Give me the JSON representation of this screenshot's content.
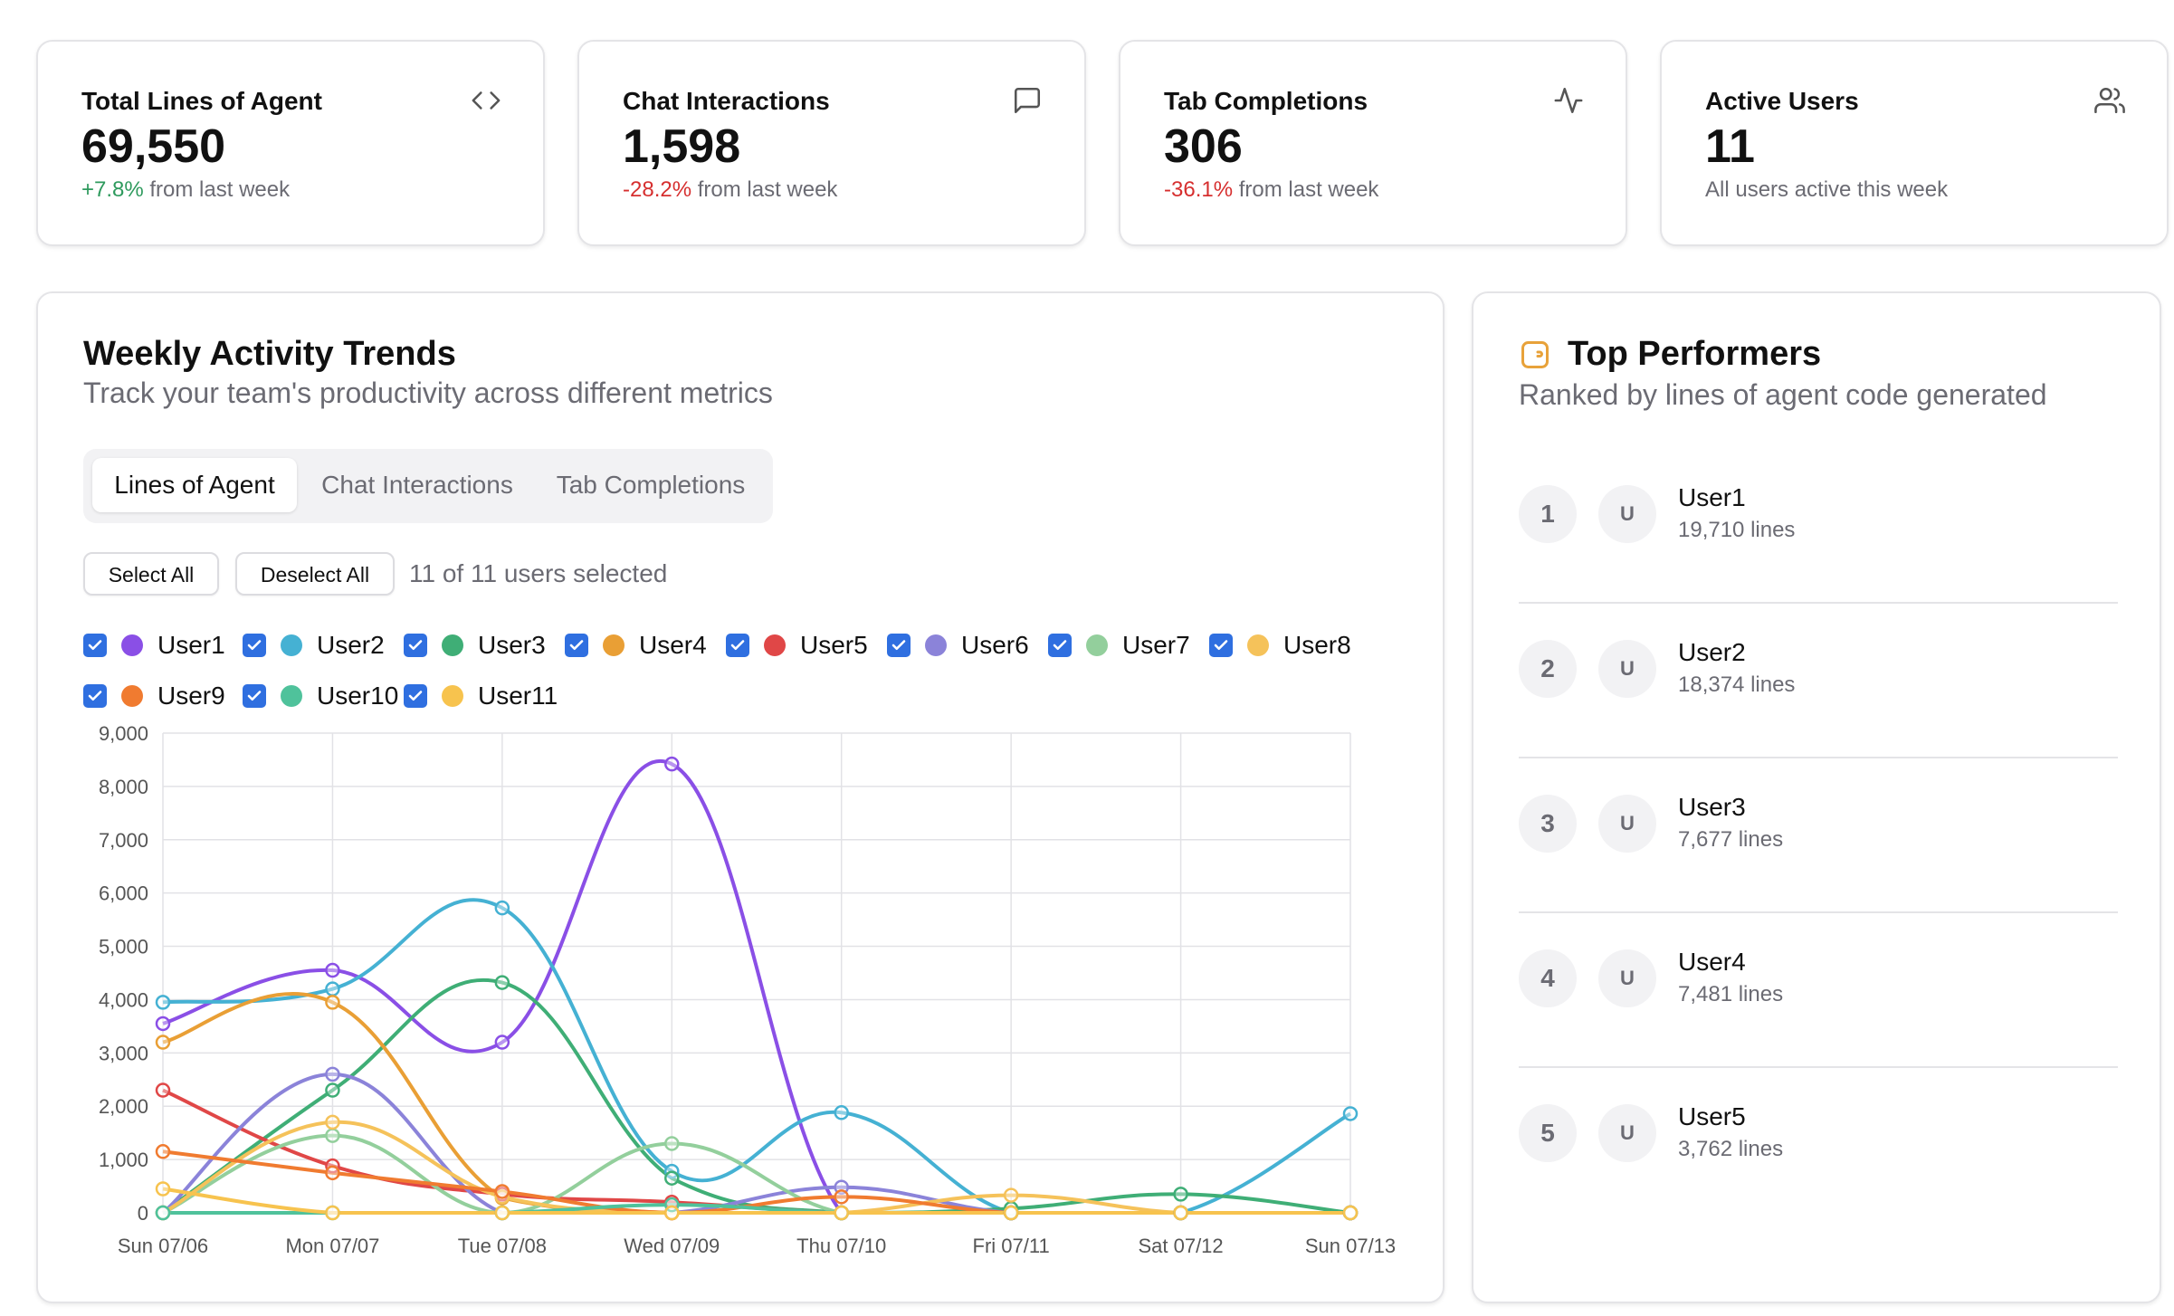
{
  "stats": [
    {
      "title": "Total Lines of Agent",
      "value": "69,550",
      "change": "+7.8%",
      "change_dir": "pos",
      "suffix": " from last week",
      "icon": "code-icon"
    },
    {
      "title": "Chat Interactions",
      "value": "1,598",
      "change": "-28.2%",
      "change_dir": "neg",
      "suffix": " from last week",
      "icon": "message-square-icon"
    },
    {
      "title": "Tab Completions",
      "value": "306",
      "change": "-36.1%",
      "change_dir": "neg",
      "suffix": " from last week",
      "icon": "activity-icon"
    },
    {
      "title": "Active Users",
      "value": "11",
      "change": "",
      "change_dir": "none",
      "suffix": "All users active this week",
      "icon": "users-icon"
    }
  ],
  "trends": {
    "title": "Weekly Activity Trends",
    "subtitle": "Track your team's productivity across different metrics",
    "tabs": [
      "Lines of Agent",
      "Chat Interactions",
      "Tab Completions"
    ],
    "active_tab": 0,
    "select_all_label": "Select All",
    "deselect_all_label": "Deselect All",
    "selection_text": "11 of 11 users selected"
  },
  "performers": {
    "title": "Top Performers",
    "subtitle": "Ranked by lines of agent code generated",
    "icon": "trophy-icon",
    "avatar_letter": "U",
    "items": [
      {
        "rank": "1",
        "name": "User1",
        "lines": "19,710 lines"
      },
      {
        "rank": "2",
        "name": "User2",
        "lines": "18,374 lines"
      },
      {
        "rank": "3",
        "name": "User3",
        "lines": "7,677 lines"
      },
      {
        "rank": "4",
        "name": "User4",
        "lines": "7,481 lines"
      },
      {
        "rank": "5",
        "name": "User5",
        "lines": "3,762 lines"
      }
    ]
  },
  "colors": {
    "checkbox": "#2f6fe0",
    "positive": "#2e9a5d",
    "negative": "#d62f2f",
    "trophy": "#e8a23a"
  },
  "chart_data": {
    "type": "line",
    "title": "",
    "xlabel": "",
    "ylabel": "",
    "ylim": [
      0,
      9000
    ],
    "yticks": [
      "0",
      "1,000",
      "2,000",
      "3,000",
      "4,000",
      "5,000",
      "6,000",
      "7,000",
      "8,000",
      "9,000"
    ],
    "categories": [
      "Sun 07/06",
      "Mon 07/07",
      "Tue 07/08",
      "Wed 07/09",
      "Thu 07/10",
      "Fri 07/11",
      "Sat 07/12",
      "Sun 07/13"
    ],
    "grid": true,
    "legend_position": "top",
    "series": [
      {
        "name": "User1",
        "color": "#8a4fe6",
        "checked": true,
        "values": [
          3550,
          4550,
          3200,
          8420,
          0,
          0,
          0,
          0
        ]
      },
      {
        "name": "User2",
        "color": "#45b1d3",
        "checked": true,
        "values": [
          3950,
          4200,
          5720,
          780,
          1880,
          0,
          0,
          1860
        ]
      },
      {
        "name": "User3",
        "color": "#3fae76",
        "checked": true,
        "values": [
          0,
          2300,
          4320,
          650,
          0,
          80,
          350,
          0
        ]
      },
      {
        "name": "User4",
        "color": "#e99f35",
        "checked": true,
        "values": [
          3200,
          3950,
          280,
          0,
          0,
          0,
          0,
          0
        ]
      },
      {
        "name": "User5",
        "color": "#e04747",
        "checked": true,
        "values": [
          2300,
          880,
          350,
          200,
          0,
          0,
          0,
          0
        ]
      },
      {
        "name": "User6",
        "color": "#8b83d9",
        "checked": true,
        "values": [
          0,
          2600,
          0,
          0,
          480,
          0,
          0,
          0
        ]
      },
      {
        "name": "User7",
        "color": "#93cf9c",
        "checked": true,
        "values": [
          0,
          1450,
          0,
          1300,
          0,
          0,
          0,
          0
        ]
      },
      {
        "name": "User8",
        "color": "#f5c25a",
        "checked": true,
        "values": [
          0,
          1700,
          300,
          0,
          0,
          330,
          0,
          0
        ]
      },
      {
        "name": "User9",
        "color": "#f07b30",
        "checked": true,
        "values": [
          1150,
          750,
          400,
          0,
          300,
          0,
          0,
          0
        ]
      },
      {
        "name": "User10",
        "color": "#4fc29b",
        "checked": true,
        "values": [
          0,
          0,
          0,
          150,
          0,
          0,
          0,
          0
        ]
      },
      {
        "name": "User11",
        "color": "#f7c34e",
        "checked": true,
        "values": [
          450,
          0,
          0,
          0,
          0,
          0,
          0,
          0
        ]
      }
    ]
  }
}
